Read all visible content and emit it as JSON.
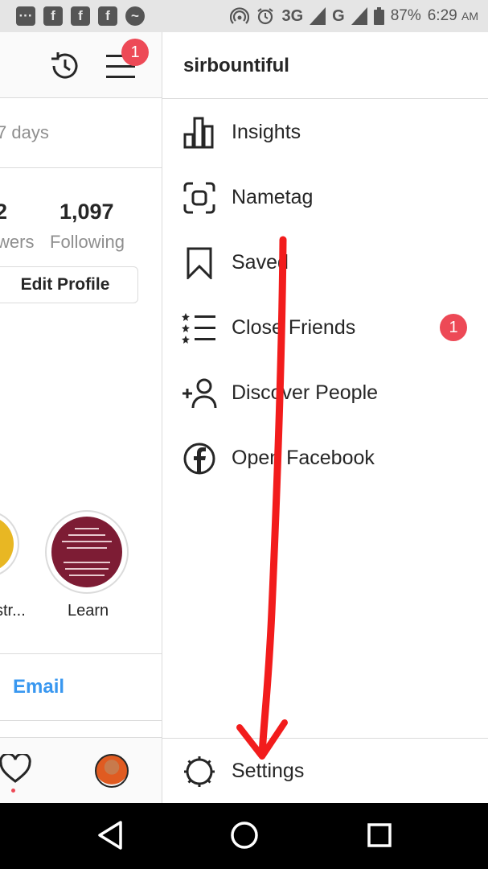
{
  "status_bar": {
    "network": "3G",
    "carrier_signal": "G",
    "battery": "87%",
    "time": "6:29",
    "ampm": "AM",
    "icons": [
      "message-icon",
      "facebook-icon",
      "facebook-icon",
      "facebook-icon",
      "messenger-icon",
      "hotspot-icon",
      "alarm-icon",
      "signal-icon",
      "battery-icon"
    ]
  },
  "profile": {
    "days_text": "7 days",
    "followers_count": "2",
    "followers_label": "wers",
    "following_count": "1,097",
    "following_label": "Following",
    "edit_profile_label": "Edit Profile",
    "notification_count": "1",
    "highlights": [
      {
        "label": "str...",
        "color": "#e8b723"
      },
      {
        "label": "Learn",
        "color": "#7d1c34"
      }
    ],
    "email_label": "Email"
  },
  "drawer": {
    "username": "sirbountiful",
    "items": [
      {
        "label": "Insights",
        "icon": "insights-icon"
      },
      {
        "label": "Nametag",
        "icon": "nametag-icon"
      },
      {
        "label": "Saved",
        "icon": "bookmark-icon"
      },
      {
        "label": "Close Friends",
        "icon": "close-friends-icon",
        "badge": "1"
      },
      {
        "label": "Discover People",
        "icon": "add-person-icon"
      },
      {
        "label": "Open Facebook",
        "icon": "facebook-icon"
      }
    ],
    "settings_label": "Settings"
  },
  "nav": {
    "buttons": [
      "back-icon",
      "home-icon",
      "recents-icon"
    ]
  },
  "colors": {
    "accent_blue": "#3897f0",
    "badge_red": "#ed4956",
    "annotation_red": "#f21c1c"
  }
}
